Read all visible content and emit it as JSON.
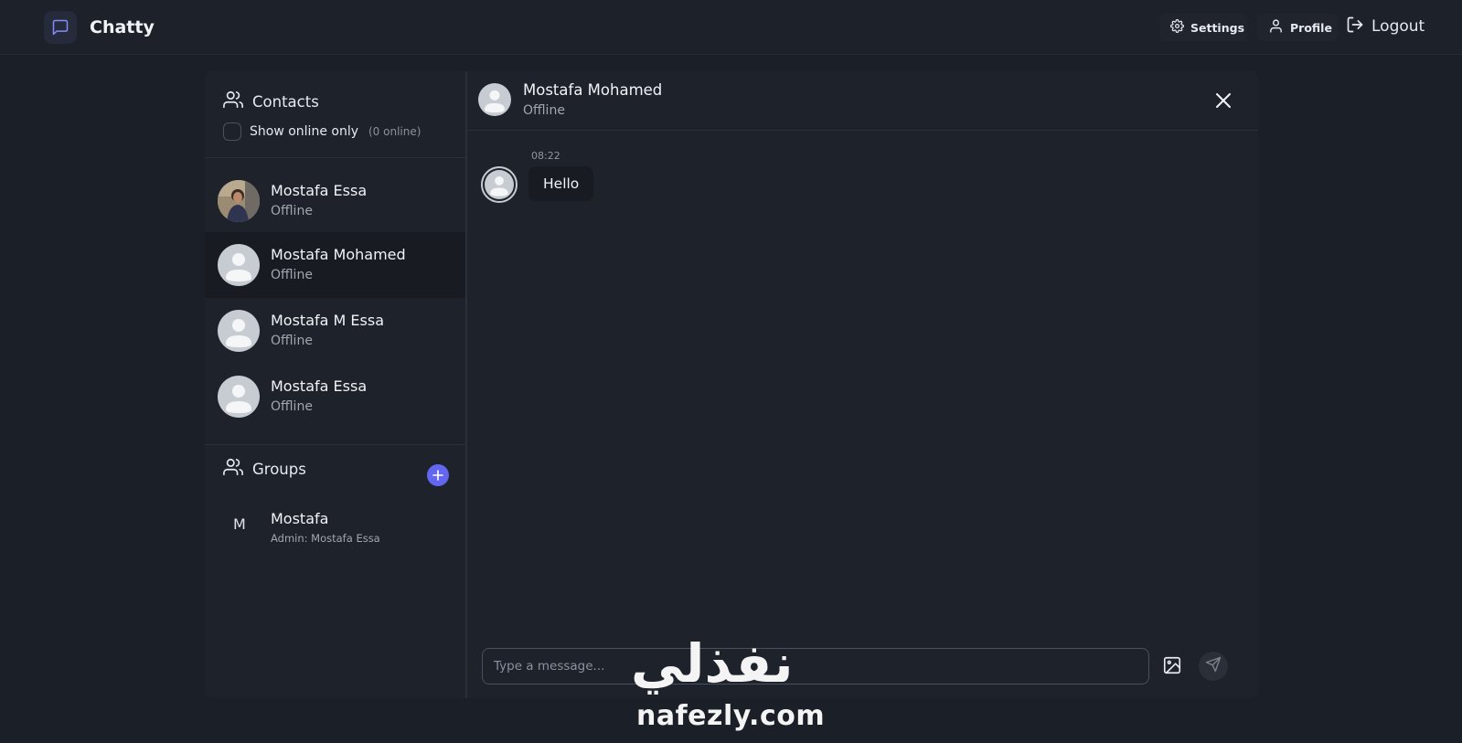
{
  "app": {
    "name": "Chatty"
  },
  "nav": {
    "settings_label": "Settings",
    "profile_label": "Profile",
    "logout_label": "Logout"
  },
  "sidebar": {
    "contacts_title": "Contacts",
    "online_filter_label": "Show online only",
    "online_count": "(0 online)",
    "contacts": [
      {
        "name": "Mostafa Essa",
        "status": "Offline",
        "avatar": "photo"
      },
      {
        "name": "Mostafa Mohamed",
        "status": "Offline",
        "avatar": "default",
        "active": true
      },
      {
        "name": "Mostafa M Essa",
        "status": "Offline",
        "avatar": "default"
      },
      {
        "name": "Mostafa Essa",
        "status": "Offline",
        "avatar": "default"
      }
    ],
    "groups_title": "Groups",
    "groups": [
      {
        "initial": "M",
        "name": "Mostafa",
        "admin": "Admin: Mostafa Essa"
      }
    ]
  },
  "chat": {
    "contact_name": "Mostafa Mohamed",
    "contact_status": "Offline",
    "messages": [
      {
        "time": "08:22",
        "text": "Hello"
      }
    ],
    "input_placeholder": "Type a message..."
  },
  "watermark": {
    "arabic": "نفذلي",
    "latin": "nafezly.com"
  },
  "colors": {
    "accent": "#6366f1",
    "background": "#1b1f28",
    "panel": "#1e222b",
    "active_row": "#181b22"
  }
}
